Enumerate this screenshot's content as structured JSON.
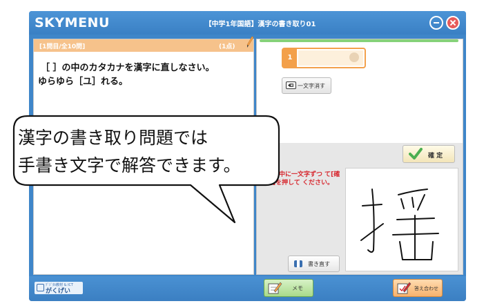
{
  "app": {
    "logo": "SKYMENU",
    "title": "【中学1年国語】漢字の書き取り01"
  },
  "question": {
    "number": "[1問目/全10問]",
    "points": "(1点)",
    "line1": "［ ］の中のカタカナを漢字に直しなさい。",
    "line2": "ゆらゆら［ユ］れる。"
  },
  "answer": {
    "slot_number": "1",
    "delete_label": "一文字消す",
    "confirm_label": "確 定",
    "instruction": "枠の中に一文字ずつ て[確定]を押して ください。",
    "rewrite_label": "書き直す"
  },
  "footer": {
    "brand_small": "ﾃﾞｼﾞﾀﾙ教材 & ICT",
    "brand_label": "がくげい",
    "memo_label": "メモ",
    "check_label": "答え合わせ"
  },
  "bubble": {
    "line1": "漢字の書き取り問題では",
    "line2": "手書き文字で解答できます。"
  },
  "colors": {
    "frame": "#3f86c9",
    "question_header": "#f6c28b",
    "accent_orange": "#f3a04a",
    "instruction_red": "#d7282f",
    "progress_green": "#86d27a"
  }
}
